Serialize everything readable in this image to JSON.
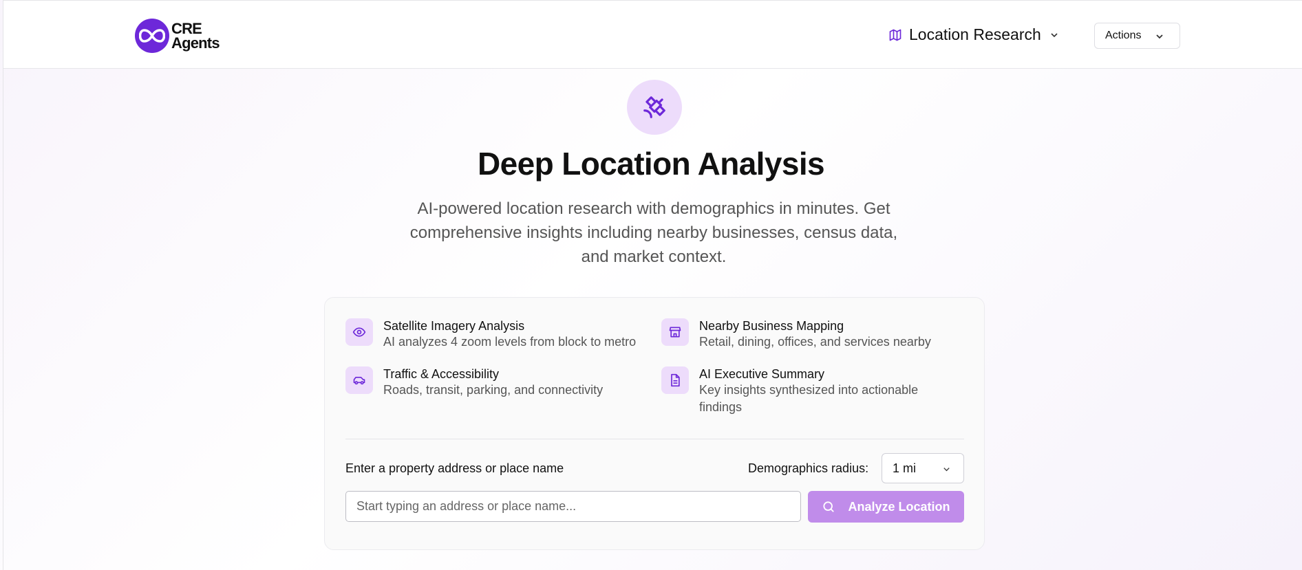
{
  "brand": {
    "line1": "CRE",
    "line2": "Agents"
  },
  "nav": {
    "location_label": "Location Research",
    "actions_label": "Actions"
  },
  "hero": {
    "title": "Deep Location Analysis",
    "subtitle": "AI-powered location research with demographics in minutes. Get comprehensive insights including nearby businesses, census data, and market context."
  },
  "features": [
    {
      "icon": "eye-icon",
      "title": "Satellite Imagery Analysis",
      "desc": "AI analyzes 4 zoom levels from block to metro"
    },
    {
      "icon": "store-icon",
      "title": "Nearby Business Mapping",
      "desc": "Retail, dining, offices, and services nearby"
    },
    {
      "icon": "car-icon",
      "title": "Traffic & Accessibility",
      "desc": "Roads, transit, parking, and connectivity"
    },
    {
      "icon": "document-icon",
      "title": "AI Executive Summary",
      "desc": "Key insights synthesized into actionable findings"
    }
  ],
  "form": {
    "address_label": "Enter a property address or place name",
    "address_placeholder": "Start typing an address or place name...",
    "address_value": "",
    "radius_label": "Demographics radius:",
    "radius_value": "1 mi",
    "analyze_label": "Analyze Location"
  },
  "colors": {
    "accent": "#6d28d9",
    "accent_soft": "#eddcfb",
    "button": "#c08cea"
  }
}
